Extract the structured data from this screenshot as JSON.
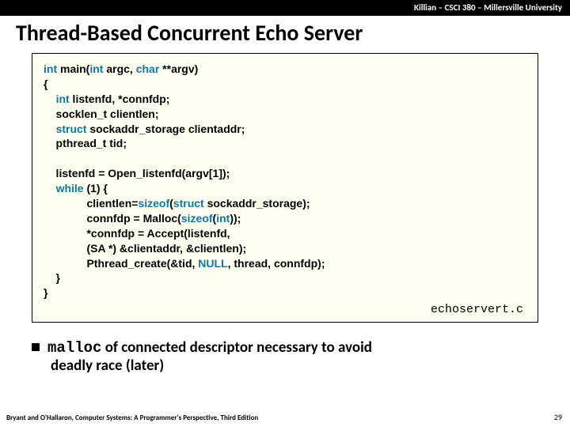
{
  "header": {
    "course": "Killian – CSCI 380 – Millersville University"
  },
  "title": "Thread-Based Concurrent Echo Server",
  "code": {
    "sig_l": "int",
    "sig_m1": " main(",
    "sig_argc_t": "int",
    "sig_argc": " argc, ",
    "sig_argv_t": "char",
    "sig_argv": " **argv)",
    "l_open": "{",
    "d1_a": "    ",
    "d1_t": "int",
    "d1_b": " listenfd, *connfdp;",
    "d2": "    socklen_t clientlen;",
    "d3_a": "    ",
    "d3_t": "struct",
    "d3_b": " sockaddr_storage clientaddr;",
    "d4": "    pthread_t tid;",
    "blank": " ",
    "b1": "    listenfd = Open_listenfd(argv[1]);",
    "b2_a": "    ",
    "b2_t": "while",
    "b2_b": " (1) {",
    "b3_a": "              clientlen=",
    "b3_t1": "sizeof",
    "b3_b": "(",
    "b3_t2": "struct",
    "b3_c": " sockaddr_storage);",
    "b4_a": "              connfdp = Malloc(",
    "b4_t1": "sizeof",
    "b4_b": "(",
    "b4_t2": "int",
    "b4_c": "));",
    "b5": "              *connfdp = Accept(listenfd,",
    "b6": "              (SA *) &clientaddr, &clientlen);",
    "b7_a": "              Pthread_create(&tid, ",
    "b7_t": "NULL",
    "b7_b": ", thread, connfdp);",
    "b8": "    }",
    "l_close": "}",
    "filename": "echoservert.c"
  },
  "bullet": {
    "part1": "malloc",
    "part2": " of connected descriptor necessary to avoid",
    "part3": "deadly race (later)"
  },
  "footer": "Bryant and O'Hallaron, Computer Systems: A Programmer's Perspective, Third Edition",
  "page": "29"
}
